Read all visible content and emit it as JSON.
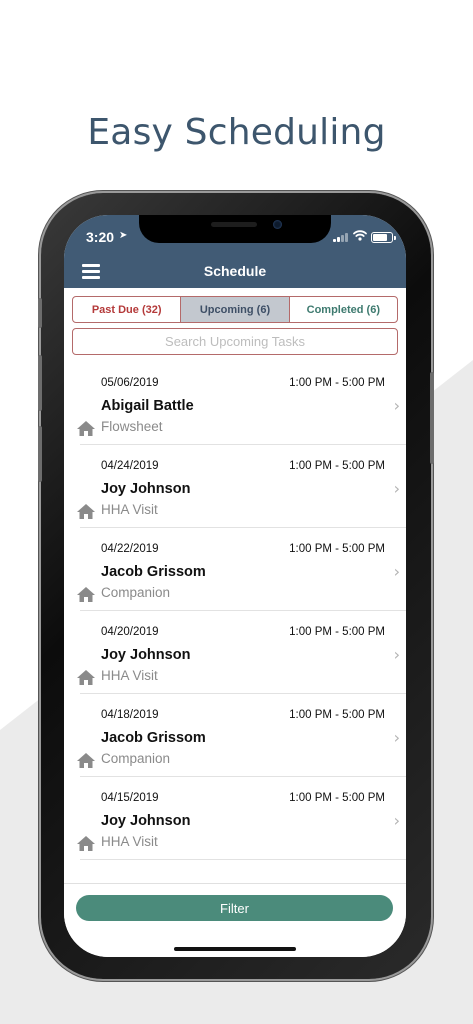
{
  "headline": "Easy Scheduling",
  "status_bar": {
    "time": "3:20"
  },
  "nav": {
    "title": "Schedule"
  },
  "tabs": [
    {
      "label": "Past Due (32)",
      "active": false
    },
    {
      "label": "Upcoming (6)",
      "active": true
    },
    {
      "label": "Completed (6)",
      "active": false
    }
  ],
  "search": {
    "placeholder": "Search Upcoming Tasks"
  },
  "tasks": [
    {
      "date": "05/06/2019",
      "time": "1:00 PM - 5:00 PM",
      "name": "Abigail Battle",
      "type": "Flowsheet"
    },
    {
      "date": "04/24/2019",
      "time": "1:00 PM - 5:00 PM",
      "name": "Joy Johnson",
      "type": "HHA Visit"
    },
    {
      "date": "04/22/2019",
      "time": "1:00 PM - 5:00 PM",
      "name": "Jacob Grissom",
      "type": "Companion"
    },
    {
      "date": "04/20/2019",
      "time": "1:00 PM - 5:00 PM",
      "name": "Joy Johnson",
      "type": "HHA Visit"
    },
    {
      "date": "04/18/2019",
      "time": "1:00 PM - 5:00 PM",
      "name": "Jacob Grissom",
      "type": "Companion"
    },
    {
      "date": "04/15/2019",
      "time": "1:00 PM - 5:00 PM",
      "name": "Joy Johnson",
      "type": "HHA Visit"
    }
  ],
  "filter_button": {
    "label": "Filter"
  },
  "colors": {
    "header": "#415b75",
    "accent_green": "#4b8b7b",
    "tab_border": "#b46a6a",
    "past_due": "#b43a3a",
    "headline": "#3d566d"
  },
  "icons": {
    "menu": "hamburger-icon",
    "row_type": "home-icon",
    "row_action": "chevron-right-icon"
  }
}
